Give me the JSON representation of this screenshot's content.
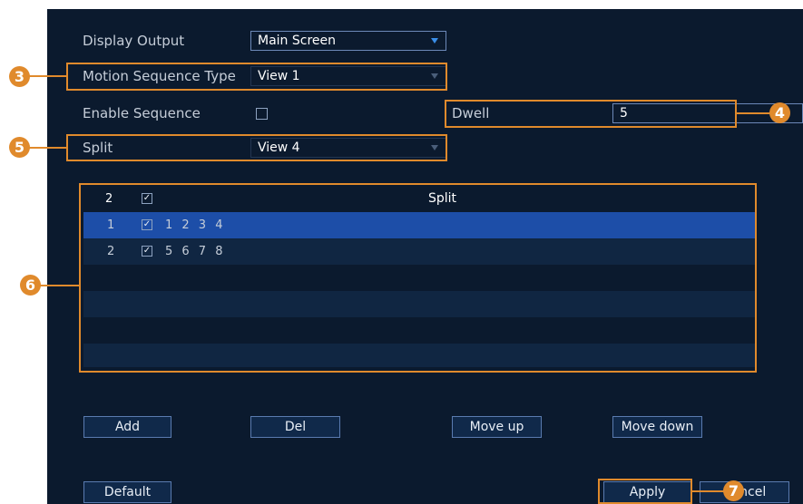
{
  "form": {
    "display_output": {
      "label": "Display Output",
      "value": "Main Screen"
    },
    "motion_sequence_type": {
      "label": "Motion Sequence Type",
      "value": "View 1"
    },
    "enable_sequence": {
      "label": "Enable Sequence",
      "checked": false
    },
    "dwell": {
      "label": "Dwell",
      "value": "5"
    },
    "split": {
      "label": "Split",
      "value": "View 4"
    }
  },
  "table": {
    "header": {
      "count": "2",
      "checked": true,
      "title": "Split"
    },
    "rows": [
      {
        "index": "1",
        "checked": true,
        "channels": "1 2 3 4",
        "selected": true
      },
      {
        "index": "2",
        "checked": true,
        "channels": "5 6 7 8",
        "selected": false
      }
    ]
  },
  "buttons": {
    "add": "Add",
    "del": "Del",
    "move_up": "Move up",
    "move_down": "Move down",
    "default": "Default",
    "apply": "Apply",
    "cancel": "Cancel"
  },
  "callouts": [
    "3",
    "4",
    "5",
    "6",
    "7"
  ],
  "colors": {
    "panel_bg": "#0b1a2e",
    "selected_row": "#1d4ea8",
    "callout": "#e08a2c",
    "dropdown_arrow": "#3a8ee8"
  }
}
